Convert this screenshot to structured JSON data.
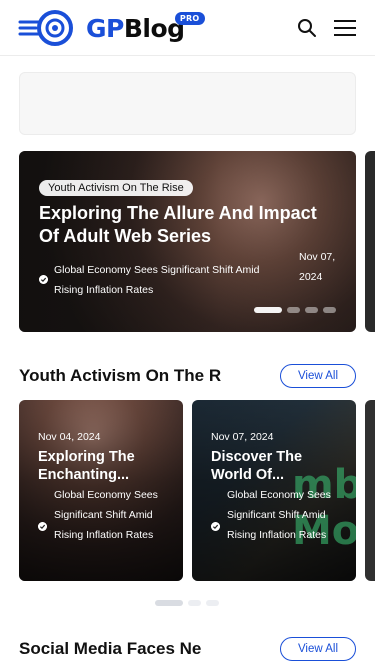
{
  "header": {
    "logo_gp": "GP",
    "logo_blog": "Blog",
    "logo_badge": "PRO",
    "search_icon": "search-icon",
    "menu_icon": "hamburger-menu-icon",
    "brand_color": "#1a4fd8"
  },
  "hero": {
    "tag": "Youth Activism On The Rise",
    "title": "Exploring The Allure And Impact Of Adult Web Series",
    "category": "Global Economy Sees Significant Shift Amid Rising Inflation Rates",
    "date": "Nov 07, 2024",
    "slide_count": 4,
    "active_slide": 1
  },
  "sections": [
    {
      "title": "Youth Activism On The R",
      "view_all": "View All",
      "cards": [
        {
          "date": "Nov 04, 2024",
          "title": "Exploring The Enchanting...",
          "category": "Global Economy Sees Significant Shift Amid Rising Inflation Rates"
        },
        {
          "date": "Nov 07, 2024",
          "title": "Discover The World Of...",
          "category": "Global Economy Sees Significant Shift Amid Rising Inflation Rates",
          "image_text": "mb Mo"
        }
      ],
      "page_count": 3,
      "active_page": 1
    },
    {
      "title": "Social Media Faces Ne",
      "view_all": "View All"
    }
  ]
}
